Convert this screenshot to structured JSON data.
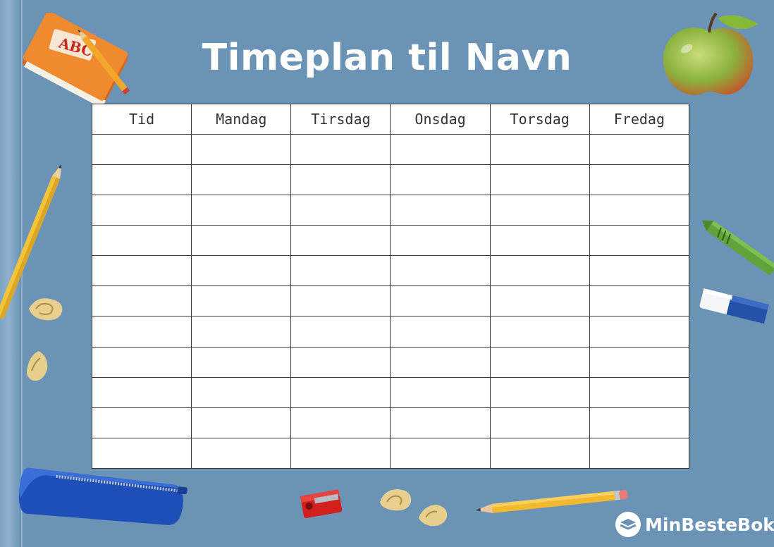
{
  "title": "Timeplan til Navn",
  "table": {
    "headers": [
      "Tid",
      "Mandag",
      "Tirsdag",
      "Onsdag",
      "Torsdag",
      "Fredag"
    ],
    "rows": [
      [
        "",
        "",
        "",
        "",
        "",
        ""
      ],
      [
        "",
        "",
        "",
        "",
        "",
        ""
      ],
      [
        "",
        "",
        "",
        "",
        "",
        ""
      ],
      [
        "",
        "",
        "",
        "",
        "",
        ""
      ],
      [
        "",
        "",
        "",
        "",
        "",
        ""
      ],
      [
        "",
        "",
        "",
        "",
        "",
        ""
      ],
      [
        "",
        "",
        "",
        "",
        "",
        ""
      ],
      [
        "",
        "",
        "",
        "",
        "",
        ""
      ],
      [
        "",
        "",
        "",
        "",
        "",
        ""
      ],
      [
        "",
        "",
        "",
        "",
        "",
        ""
      ],
      [
        "",
        "",
        "",
        "",
        "",
        ""
      ]
    ]
  },
  "book_label": "ABC",
  "brand": {
    "name": "MinBesteBok",
    "icon": "book-logo-icon"
  },
  "colors": {
    "background": "#6a93b5",
    "table_border": "#3a3a3a"
  },
  "decorations": [
    "abc-book-icon",
    "pencil-icon",
    "apple-icon",
    "crayon-icon",
    "eraser-icon",
    "pencil-case-icon",
    "sharpener-icon",
    "pencil-shaving-icon"
  ]
}
